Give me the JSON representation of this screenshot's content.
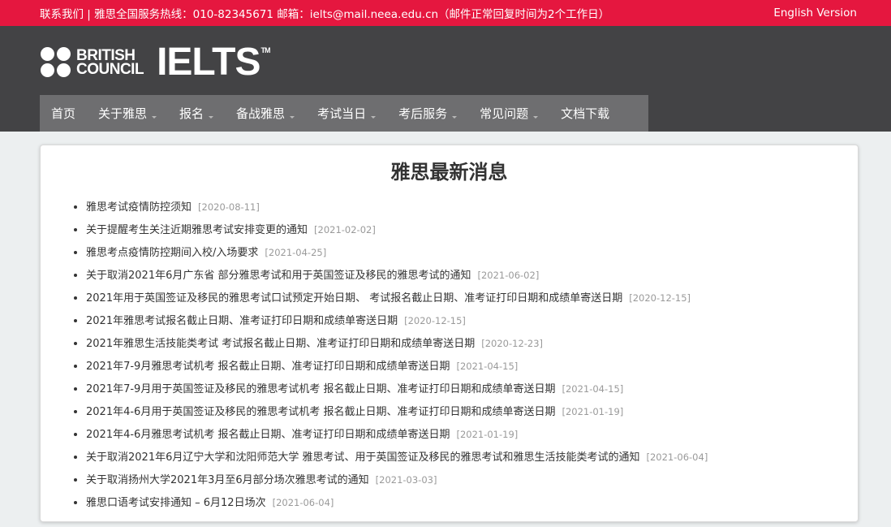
{
  "topbar": {
    "contact": "联系我们 | 雅思全国服务热线：010-82345671   邮箱：ielts@mail.neea.edu.cn（邮件正常回复时间为2个工作日）",
    "english_link": "English Version"
  },
  "logo": {
    "bc_line1": "BRITISH",
    "bc_line2": "COUNCIL",
    "ielts": "IELTS",
    "tm": "TM"
  },
  "nav": {
    "items": [
      {
        "label": "首页",
        "dropdown": false
      },
      {
        "label": "关于雅思",
        "dropdown": true
      },
      {
        "label": "报名",
        "dropdown": true
      },
      {
        "label": "备战雅思",
        "dropdown": true
      },
      {
        "label": "考试当日",
        "dropdown": true
      },
      {
        "label": "考后服务",
        "dropdown": true
      },
      {
        "label": "常见问题",
        "dropdown": true
      },
      {
        "label": "文档下载",
        "dropdown": false
      }
    ]
  },
  "main": {
    "title": "雅思最新消息",
    "news": [
      {
        "title": "雅思考试疫情防控须知",
        "date": "[2020-08-11]"
      },
      {
        "title": "关于提醒考生关注近期雅思考试安排变更的通知",
        "date": "[2021-02-02]"
      },
      {
        "title": "雅思考点疫情防控期间入校/入场要求",
        "date": "[2021-04-25]"
      },
      {
        "title": "关于取消2021年6月广东省 部分雅思考试和用于英国签证及移民的雅思考试的通知",
        "date": "[2021-06-02]"
      },
      {
        "title": "2021年用于英国签证及移民的雅思考试口试预定开始日期、 考试报名截止日期、准考证打印日期和成绩单寄送日期",
        "date": "[2020-12-15]"
      },
      {
        "title": "2021年雅思考试报名截止日期、准考证打印日期和成绩单寄送日期",
        "date": "[2020-12-15]"
      },
      {
        "title": "2021年雅思生活技能类考试 考试报名截止日期、准考证打印日期和成绩单寄送日期",
        "date": "[2020-12-23]"
      },
      {
        "title": "2021年7-9月雅思考试机考 报名截止日期、准考证打印日期和成绩单寄送日期",
        "date": "[2021-04-15]"
      },
      {
        "title": "2021年7-9月用于英国签证及移民的雅思考试机考 报名截止日期、准考证打印日期和成绩单寄送日期",
        "date": "[2021-04-15]"
      },
      {
        "title": "2021年4-6月用于英国签证及移民的雅思考试机考 报名截止日期、准考证打印日期和成绩单寄送日期",
        "date": "[2021-01-19]"
      },
      {
        "title": "2021年4-6月雅思考试机考 报名截止日期、准考证打印日期和成绩单寄送日期",
        "date": "[2021-01-19]"
      },
      {
        "title": "关于取消2021年6月辽宁大学和沈阳师范大学 雅思考试、用于英国签证及移民的雅思考试和雅思生活技能类考试的通知",
        "date": "[2021-06-04]"
      },
      {
        "title": "关于取消扬州大学2021年3月至6月部分场次雅思考试的通知",
        "date": "[2021-03-03]"
      },
      {
        "title": "雅思口语考试安排通知 – 6月12日场次",
        "date": "[2021-06-04]"
      }
    ]
  },
  "colors": {
    "topbar_bg": "#e5173f",
    "header_bg": "#434345",
    "nav_bg": "#6e6e70",
    "page_bg": "#eceff0"
  }
}
